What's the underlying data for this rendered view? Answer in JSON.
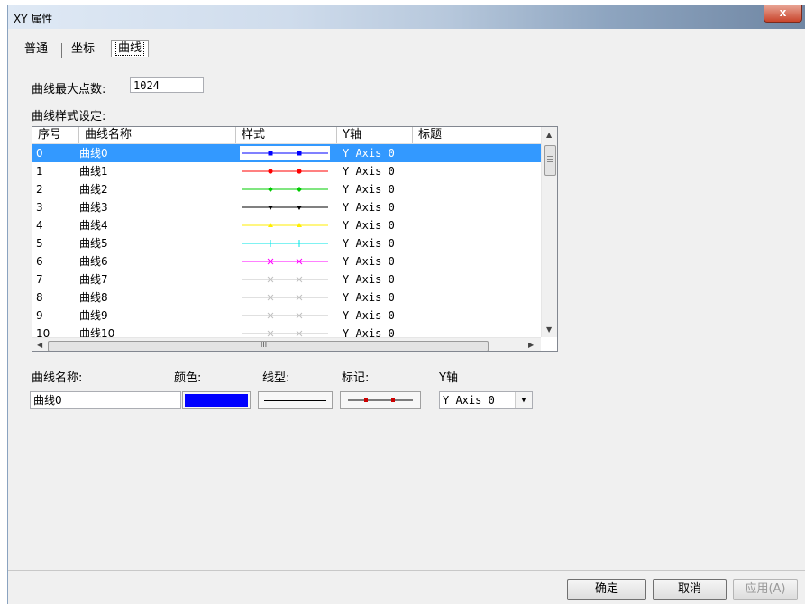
{
  "window": {
    "title": "XY 属性",
    "close_label": "x"
  },
  "tabs": [
    {
      "label": "普通"
    },
    {
      "label": "坐标"
    },
    {
      "label": "曲线"
    }
  ],
  "max_points": {
    "label": "曲线最大点数:",
    "value": "1024"
  },
  "style_section": {
    "label": "曲线样式设定:"
  },
  "table": {
    "columns": [
      "序号",
      "曲线名称",
      "样式",
      "Y轴",
      "标题"
    ],
    "rows": [
      {
        "index": "0",
        "name": "曲线0",
        "axis": "Y Axis 0",
        "color": "#0000ff",
        "marker": "square"
      },
      {
        "index": "1",
        "name": "曲线1",
        "axis": "Y Axis 0",
        "color": "#ff0000",
        "marker": "circle"
      },
      {
        "index": "2",
        "name": "曲线2",
        "axis": "Y Axis 0",
        "color": "#00cc00",
        "marker": "diamond"
      },
      {
        "index": "3",
        "name": "曲线3",
        "axis": "Y Axis 0",
        "color": "#000000",
        "marker": "triangle-down"
      },
      {
        "index": "4",
        "name": "曲线4",
        "axis": "Y Axis 0",
        "color": "#ffee00",
        "marker": "triangle-up"
      },
      {
        "index": "5",
        "name": "曲线5",
        "axis": "Y Axis 0",
        "color": "#00e5e5",
        "marker": "plus"
      },
      {
        "index": "6",
        "name": "曲线6",
        "axis": "Y Axis 0",
        "color": "#ff00ff",
        "marker": "cross"
      },
      {
        "index": "7",
        "name": "曲线7",
        "axis": "Y Axis 0",
        "color": "#c0c0c0",
        "marker": "cross"
      },
      {
        "index": "8",
        "name": "曲线8",
        "axis": "Y Axis 0",
        "color": "#c0c0c0",
        "marker": "cross"
      },
      {
        "index": "9",
        "name": "曲线9",
        "axis": "Y Axis 0",
        "color": "#c0c0c0",
        "marker": "cross"
      },
      {
        "index": "10",
        "name": "曲线10",
        "axis": "Y Axis 0",
        "color": "#c0c0c0",
        "marker": "cross"
      }
    ],
    "hscroll_mark": "III"
  },
  "props": {
    "name_label": "曲线名称:",
    "name_value": "曲线0",
    "color_label": "颜色:",
    "color_value": "#0000ff",
    "linetype_label": "线型:",
    "marker_label": "标记:",
    "marker_color": "#cc0000",
    "axis_label": "Y轴",
    "axis_value": "Y Axis 0"
  },
  "footer": {
    "ok": "确定",
    "cancel": "取消",
    "apply": "应用(A)"
  }
}
